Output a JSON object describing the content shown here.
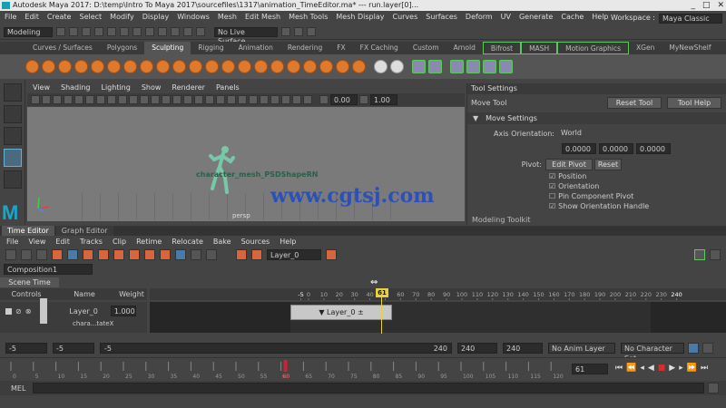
{
  "window": {
    "title": "Autodesk Maya 2017: D:\\temp\\Intro To Maya 2017\\sourcefiles\\1317\\animation_TimeEditor.ma* --- run.layer[0]...",
    "controls": [
      "_",
      "□",
      "✕"
    ]
  },
  "menubar": {
    "items": [
      "File",
      "Edit",
      "Create",
      "Select",
      "Modify",
      "Display",
      "Windows",
      "Mesh",
      "Edit Mesh",
      "Mesh Tools",
      "Mesh Display",
      "Curves",
      "Surfaces",
      "Deform",
      "UV",
      "Generate",
      "Cache",
      "Help"
    ],
    "workspace_label": "Workspace :",
    "workspace_value": "Maya Classic"
  },
  "statusline": {
    "mode": "Modeling",
    "live_surface": "No Live Surface"
  },
  "shelf": {
    "tabs": [
      "Curves / Surfaces",
      "Polygons",
      "Sculpting",
      "Rigging",
      "Animation",
      "Rendering",
      "FX",
      "FX Caching",
      "Custom",
      "Arnold",
      "Bifrost",
      "MASH",
      "Motion Graphics",
      "XGen",
      "MyNewShelf"
    ],
    "active_tab": "Sculpting"
  },
  "viewport": {
    "menu": [
      "View",
      "Shading",
      "Lighting",
      "Show",
      "Renderer",
      "Panels"
    ],
    "exposure": "0.00",
    "gamma": "1.00",
    "char_label": "character_mesh_PSDShapeRN",
    "camera": "persp"
  },
  "watermark": "www.cgtsj.com",
  "tool_settings": {
    "header": "Tool Settings",
    "tool_name": "Move Tool",
    "reset_tool": "Reset Tool",
    "tool_help": "Tool Help",
    "section": "Move Settings",
    "axis_orientation_label": "Axis Orientation:",
    "axis_orientation_value": "World",
    "xyz": [
      "0.0000",
      "0.0000",
      "0.0000"
    ],
    "pivot_label": "Pivot:",
    "edit_pivot": "Edit Pivot",
    "reset": "Reset",
    "checks": [
      "Position",
      "Orientation",
      "Pin Component Pivot",
      "Show Orientation Handle"
    ],
    "checked": [
      true,
      true,
      false,
      true
    ],
    "modeling_toolkit": "Modeling Toolkit"
  },
  "time_editor": {
    "tabs": [
      "Time Editor",
      "Graph Editor"
    ],
    "menu": [
      "File",
      "View",
      "Edit",
      "Tracks",
      "Clip",
      "Retime",
      "Relocate",
      "Bake",
      "Sources",
      "Help"
    ],
    "layer_field": "Layer_0",
    "composition": "Composition1",
    "scene_time": "Scene Time",
    "columns": {
      "controls": "Controls",
      "name": "Name",
      "weight": "Weight"
    },
    "track": {
      "name": "Layer_0",
      "weight": "1.000",
      "sub": "chara...tateX"
    },
    "clip_label": "Layer_0",
    "ruler_ticks": [
      "-5",
      "0",
      "10",
      "20",
      "30",
      "40",
      "50",
      "60",
      "70",
      "80",
      "90",
      "100",
      "110",
      "120",
      "130",
      "140",
      "150",
      "160",
      "170",
      "180",
      "190",
      "200",
      "210",
      "220",
      "230",
      "240"
    ],
    "current_frame": "61"
  },
  "range": {
    "start": "-5",
    "anim_start": "-5",
    "slider_start": "-5",
    "slider_end": "240",
    "anim_end": "240",
    "end": "240",
    "anim_layer": "No Anim Layer",
    "character_set": "No Character Set"
  },
  "timeslider": {
    "ticks": [
      "0",
      "5",
      "10",
      "15",
      "20",
      "25",
      "30",
      "35",
      "40",
      "45",
      "50",
      "55",
      "60",
      "65",
      "70",
      "75",
      "80",
      "85",
      "90",
      "95",
      "100",
      "105",
      "110",
      "115",
      "120"
    ],
    "current": "61",
    "frame_field": "61"
  },
  "mel": {
    "label": "MEL"
  }
}
